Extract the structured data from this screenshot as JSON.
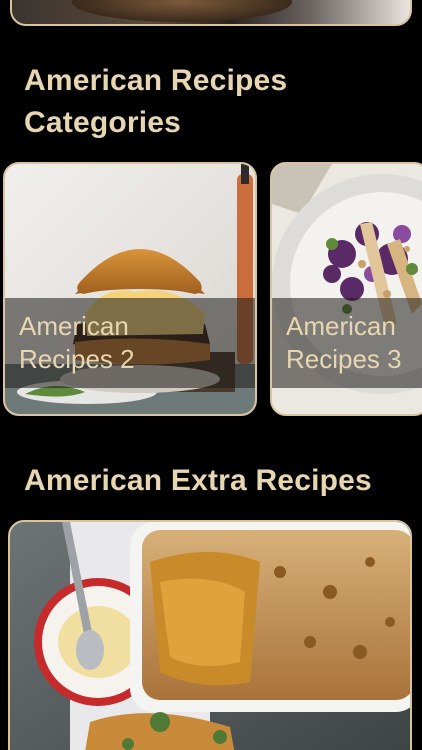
{
  "sections": {
    "categories_title": "American Recipes Categories",
    "extra_title": "American Extra Recipes"
  },
  "categories": [
    {
      "line1": "American",
      "line2": "Recipes 2",
      "image": "burger-photo"
    },
    {
      "line1": "American",
      "line2": "Recipes 3",
      "image": "salad-photo"
    }
  ],
  "extra": {
    "image": "baked-dish-photo"
  },
  "colors": {
    "accent": "#e8d6b0",
    "border": "#d8c49a",
    "background": "#000000"
  }
}
